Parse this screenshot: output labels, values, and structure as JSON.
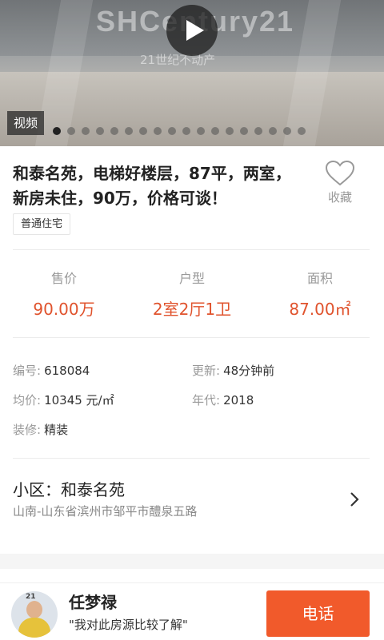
{
  "hero": {
    "video_label": "视频",
    "brand_watermark": "SHCentury21",
    "brand_sub": "21世纪不动产",
    "slide_count": 18,
    "active_slide": 0
  },
  "listing": {
    "title": "和泰名苑，电梯好楼层，87平，两室，新房未住，90万，价格可谈！",
    "favorite_label": "收藏",
    "tag": "普通住宅"
  },
  "stats": [
    {
      "label": "售价",
      "value": "90.00万"
    },
    {
      "label": "户型",
      "value": "2室2厅1卫"
    },
    {
      "label": "面积",
      "value": "87.00㎡"
    }
  ],
  "details": {
    "id_label": "编号:",
    "id_value": "618084",
    "update_label": "更新:",
    "update_value": "48分钟前",
    "unit_price_label": "均价:",
    "unit_price_value": "10345 元/㎡",
    "year_label": "年代:",
    "year_value": "2018",
    "decor_label": "装修:",
    "decor_value": "精装"
  },
  "community": {
    "label": "小区：和泰名苑",
    "address": "山南-山东省滨州市邹平市醴泉五路"
  },
  "agent": {
    "name": "任梦禄",
    "quote": "\"我对此房源比较了解\"",
    "call_label": "电话",
    "avatar_logo": "21"
  },
  "colors": {
    "accent": "#f15a2b",
    "price": "#e0532d"
  }
}
